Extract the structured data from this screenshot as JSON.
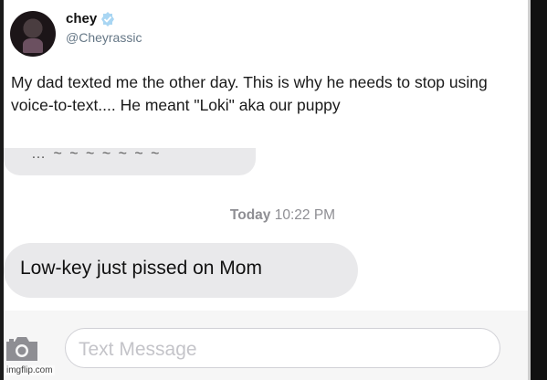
{
  "tweet": {
    "name": "chey",
    "handle": "@Cheyrassic",
    "text": "My dad texted me the other day. This is why he needs to stop using voice-to-text.... He meant \"Loki\" aka our puppy"
  },
  "messages": {
    "previous_fragment": "… ~ ~ ~ ~ ~ ~ ~",
    "timestamp_day": "Today",
    "timestamp_time": "10:22 PM",
    "received_text": "Low-key just pissed on Mom"
  },
  "input": {
    "placeholder": "Text Message"
  },
  "watermark": "imgflip.com",
  "icons": [
    "verified-badge-icon",
    "camera-icon"
  ],
  "colors": {
    "bubble_gray": "#e9e9eb",
    "timestamp_gray": "#8e8e93",
    "verified_blue": "#8ec9f0"
  }
}
